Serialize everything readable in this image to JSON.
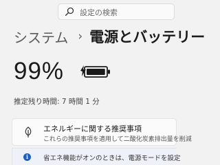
{
  "search": {
    "placeholder": "設定の検索",
    "icon": "search-icon"
  },
  "breadcrumb": {
    "parent": "システム",
    "separator": "›",
    "current": "電源とバッテリー"
  },
  "battery": {
    "percent_label": "99%",
    "level": 0.99,
    "charging": true,
    "icon": "battery-charging-icon"
  },
  "estimate": {
    "label": "推定残り時間:",
    "value": "7 時間 1 分"
  },
  "recommendation": {
    "icon": "leaf-icon",
    "title": "エネルギーに関する推奨事項",
    "description": "これらの推奨事項を適用して二酸化炭素排出量を削減"
  },
  "info_bar": {
    "icon": "info-icon",
    "text": "省エネ機能がオンのときは、電源モードを設定"
  }
}
